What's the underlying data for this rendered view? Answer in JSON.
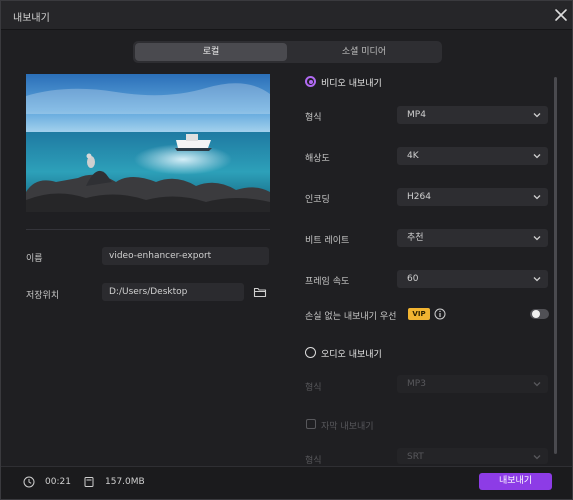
{
  "window": {
    "title": "내보내기"
  },
  "tabs": [
    {
      "label": "로컬",
      "active": true
    },
    {
      "label": "소셜 미디어",
      "active": false
    }
  ],
  "left": {
    "name_label": "이름",
    "name_value": "video-enhancer-export",
    "location_label": "저장위치",
    "location_value": "D:/Users/Desktop"
  },
  "video": {
    "title": "비디오 내보내기",
    "rows": [
      {
        "label": "형식",
        "value": "MP4"
      },
      {
        "label": "해상도",
        "value": "4K"
      },
      {
        "label": "인코딩",
        "value": "H264"
      },
      {
        "label": "비트 레이트",
        "value": "추천"
      },
      {
        "label": "프레임 속도",
        "value": "60"
      }
    ],
    "lossless_label": "손실 없는 내보내기 우선",
    "vip_badge": "VIP",
    "lossless_enabled": false
  },
  "audio": {
    "title": "오디오 내보내기",
    "format_label": "형식",
    "format_value": "MP3"
  },
  "subtitle": {
    "title": "자막 내보내기",
    "format_label": "형식",
    "format_value": "SRT"
  },
  "footer": {
    "duration": "00:21",
    "size": "157.0MB",
    "export_label": "내보내기"
  },
  "colors": {
    "accent": "#8d3ce6",
    "radio": "#b16af2",
    "vip": "#f2b431"
  },
  "icons": [
    "close-icon",
    "folder-icon",
    "info-icon",
    "clock-icon",
    "file-icon",
    "chevron-down-icon"
  ]
}
